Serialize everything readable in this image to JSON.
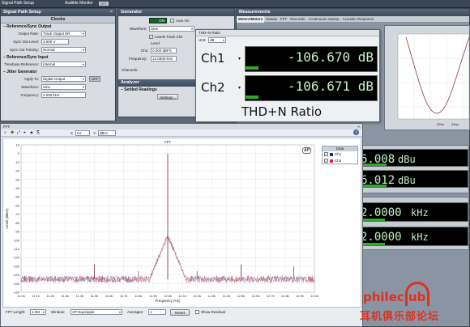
{
  "top": {
    "title": "Signal Path Setup",
    "audible_monitor": "Audible Monitor",
    "off": "OFF"
  },
  "left": {
    "clocks": "Clocks",
    "ref_sync_out": {
      "heading": "Reference/Sync Output",
      "output_rate_label": "Output Rate:",
      "output_rate": "Track Output SR",
      "sync_out_level_label": "Sync Out Level:",
      "sync_out_level": "3.000 V",
      "sync_out_polarity_label": "Sync Out Polarity:",
      "sync_out_polarity": "Normal"
    },
    "ref_sync_in": {
      "heading": "Reference/Sync Input",
      "timebase_label": "Timebase Reference:",
      "timebase": "Internal"
    },
    "jitter": {
      "heading": "Jitter Generator",
      "apply_to_label": "Apply To:",
      "apply_to": "Digital Output",
      "off": "OFF",
      "waveform_label": "Waveform:",
      "waveform": "Sine",
      "frequency_label": "Frequency:",
      "frequency": "2.000 kHz"
    }
  },
  "generator": {
    "title": "Generator",
    "on": "ON",
    "auto_on": "Auto On",
    "waveform_label": "Waveform:",
    "waveform": "Sine",
    "levels_track": "Levels Track Ch1",
    "level_label": "Level",
    "ch1_label": "Ch1:",
    "ch1_level": "0.000 dBFS",
    "frequency_label": "Frequency:",
    "frequency": "12.0000 kHz",
    "channels_label": "Channels:"
  },
  "analyzer": {
    "title": "Analyzer",
    "settled": "Settled Readings",
    "settings": "Settings..."
  },
  "measurements": {
    "title": "Measurements",
    "tabs": [
      "Meters/Meters",
      "Sweep",
      "FFT",
      "Recorder",
      "Continuous Sweep",
      "Acoustic Response"
    ]
  },
  "thdn": {
    "title": "THD+N Ratio",
    "unit_label": "Unit:",
    "unit": "dB",
    "ch1_label": "Ch1",
    "ch1_value": "-106.670 dB",
    "ch1_bar": 0.1,
    "ch2_label": "Ch2",
    "ch2_value": "-106.671 dB",
    "ch2_bar": 0.1,
    "caption": "THD+N Ratio"
  },
  "waveform_axis": [
    "220u",
    "240u"
  ],
  "right_readings": {
    "level1": "6.008",
    "level1_unit": "dBu",
    "level2": "6.012",
    "level2_unit": "dBu",
    "freq1": "2.0000",
    "freq1_unit": "kHz",
    "freq2": "2.0000",
    "freq2_unit": "kHz"
  },
  "fft": {
    "window_title": "FFT",
    "x_label": "X",
    "x_unit": "Hz",
    "y_label": "Y",
    "y_unit": "dBrA",
    "chart_title": "FFT",
    "ylabel": "Level (dBrA)",
    "xlabel": "Frequency (Hz)",
    "data_title": "Data",
    "series": [
      {
        "name": "Ch1",
        "color": "#1a2f8a"
      },
      {
        "name": "Ch2",
        "color": "#c0303a"
      }
    ],
    "ap_label": "AP",
    "fft_length_label": "FFT Length:",
    "fft_length": "1.2M",
    "window_label": "Window:",
    "window": "AP-Equiripple",
    "averages_label": "Averages:",
    "averages": "1",
    "reset": "Reset",
    "show_residual": "Show Residual"
  },
  "watermark": {
    "logo": "phileclub",
    "caption": "耳机俱乐部论坛"
  },
  "chart_data": {
    "type": "line",
    "title": "FFT",
    "xlabel": "Frequency (Hz)",
    "ylabel": "Level (dBrA)",
    "xlim": [
      11000,
      13000
    ],
    "ylim": [
      -160,
      10
    ],
    "x_ticks": [
      "11.0k",
      "11.1k",
      "11.2k",
      "11.3k",
      "11.4k",
      "11.5k",
      "11.6k",
      "11.7k",
      "11.8k",
      "11.9k",
      "12.0k",
      "12.1k",
      "12.2k",
      "12.3k",
      "12.4k",
      "12.5k",
      "12.6k",
      "12.7k",
      "12.8k",
      "12.9k",
      "13.0k"
    ],
    "y_ticks": [
      "10",
      "0",
      "-10",
      "-20",
      "-30",
      "-40",
      "-50",
      "-60",
      "-70",
      "-80",
      "-90",
      "-100",
      "-110",
      "-120",
      "-130",
      "-140",
      "-150",
      "-160"
    ],
    "series": [
      {
        "name": "Ch1",
        "color": "#1a2f8a",
        "noise_floor": -145,
        "peaks": [
          {
            "x": 12000,
            "y": 0
          },
          {
            "x": 11500,
            "y": -128
          },
          {
            "x": 11800,
            "y": -136
          },
          {
            "x": 12200,
            "y": -136
          },
          {
            "x": 12500,
            "y": -128
          },
          {
            "x": 12860,
            "y": -130
          }
        ]
      },
      {
        "name": "Ch2",
        "color": "#c0303a",
        "noise_floor": -145,
        "peaks": [
          {
            "x": 12000,
            "y": 0
          },
          {
            "x": 11500,
            "y": -128
          },
          {
            "x": 11800,
            "y": -136
          },
          {
            "x": 12200,
            "y": -136
          },
          {
            "x": 12500,
            "y": -128
          },
          {
            "x": 12860,
            "y": -130
          }
        ]
      }
    ]
  }
}
